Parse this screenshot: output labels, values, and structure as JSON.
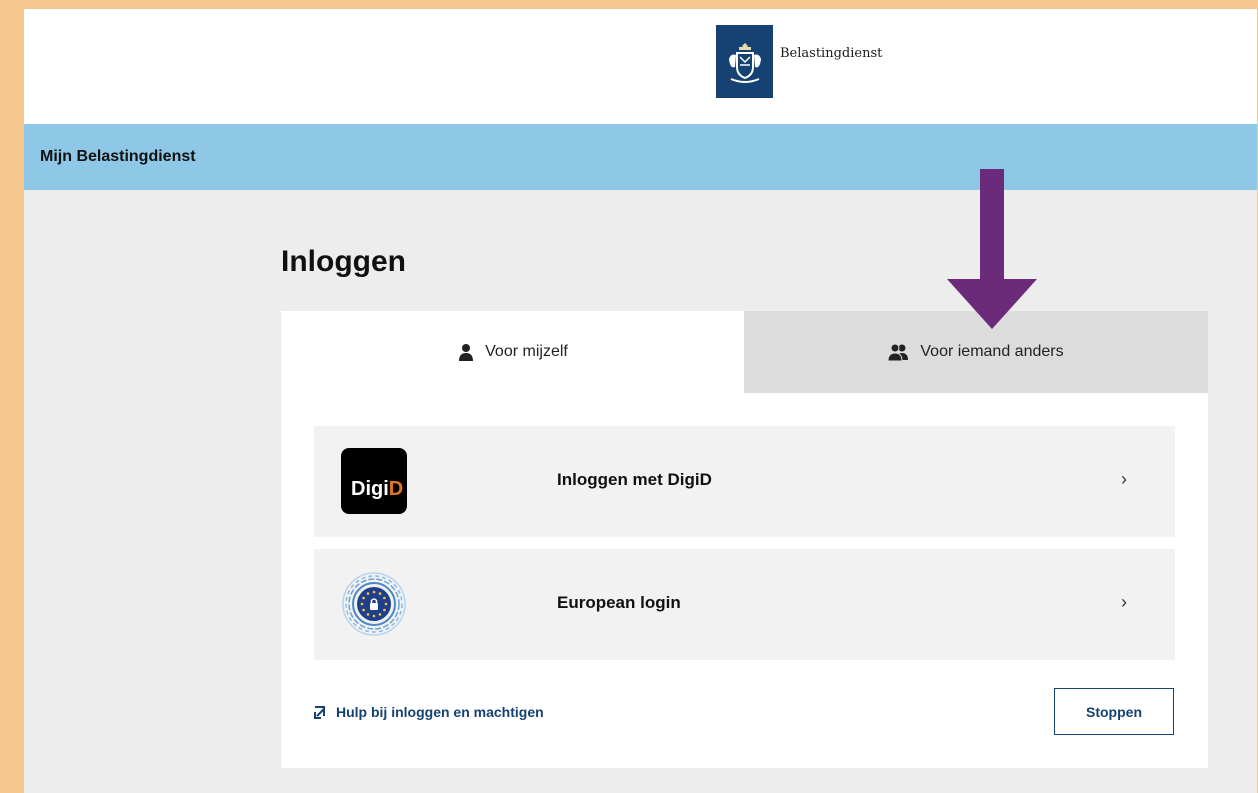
{
  "header": {
    "brand_name": "Belastingdienst",
    "app_title": "Mijn Belastingdienst"
  },
  "login": {
    "title": "Inloggen",
    "tabs": [
      {
        "label": "Voor mijzelf",
        "icon": "person-icon",
        "selected": true
      },
      {
        "label": "Voor iemand anders",
        "icon": "people-icon",
        "selected": false
      }
    ],
    "options": [
      {
        "label": "Inloggen met DigiD",
        "icon": "digid-logo"
      },
      {
        "label": "European login",
        "icon": "eidas-logo"
      }
    ],
    "digid_logo_text": {
      "part1": "Digi",
      "part2": "D"
    },
    "help_link": "Hulp bij inloggen en machtigen",
    "stop_button": "Stoppen"
  },
  "colors": {
    "brand_blue": "#154273",
    "header_bar": "#8fc8e6",
    "annotation_arrow": "#6b2a7a",
    "digid_orange": "#e0771f",
    "outer_border": "#f6c88f"
  }
}
